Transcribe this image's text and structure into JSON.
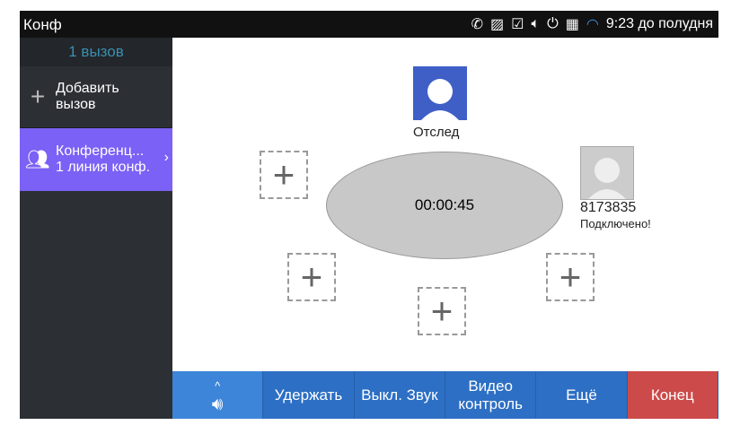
{
  "status_bar": {
    "title": "Конф",
    "time": "9:23 до полудня",
    "icons": [
      "call-icon",
      "image-icon",
      "clipboard-check-icon",
      "volume-icon",
      "power-plug-icon",
      "sim-icon",
      "wifi-icon"
    ]
  },
  "sidebar": {
    "call_count": "1 вызов",
    "add_call": "Добавить вызов",
    "conference": {
      "title": "Конференц...",
      "subtitle": "1 линия конф."
    }
  },
  "conference": {
    "timer": "00:00:45",
    "host_label": "Отслед",
    "participant": {
      "number": "8173835",
      "status": "Подключено!"
    }
  },
  "bottom_bar": {
    "hold": "Удержать",
    "mute": "Выкл. Звук",
    "video": "Видео контроль",
    "more": "Ещё",
    "end": "Конец"
  },
  "colors": {
    "accent": "#7b61f5",
    "button": "#2d6fc4",
    "end": "#cc4a4a"
  }
}
